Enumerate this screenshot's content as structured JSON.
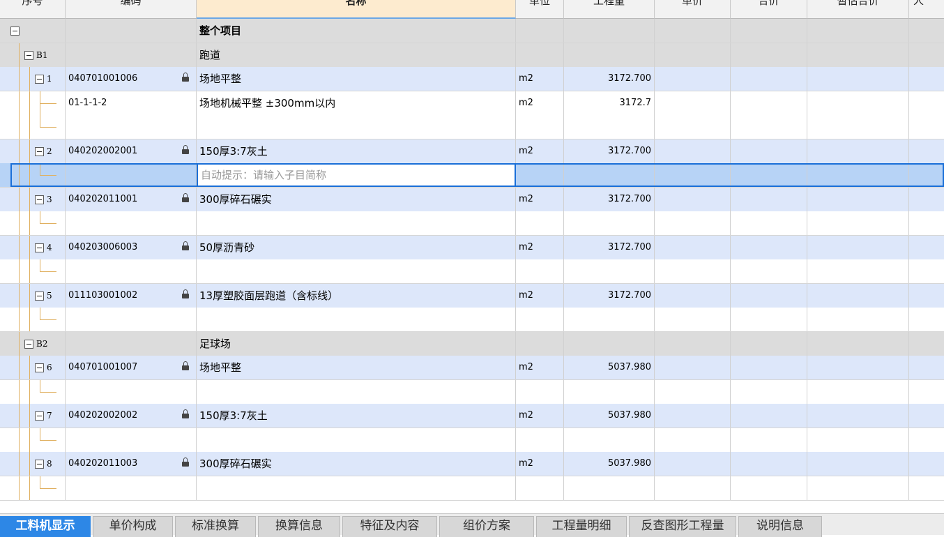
{
  "columns": {
    "seq": "序号",
    "code": "编码",
    "name": "名称",
    "unit": "单位",
    "quantity": "工程量",
    "unit_price": "单价",
    "total_price": "合价",
    "estimated_total": "暂估合价",
    "last": "人"
  },
  "rows": [
    {
      "type": "proj",
      "seq": "",
      "code": "",
      "name": "整个项目",
      "unit": "",
      "qty": ""
    },
    {
      "type": "sec",
      "seq": "B1",
      "code": "",
      "name": "跑道",
      "unit": "",
      "qty": ""
    },
    {
      "type": "item",
      "seq": "1",
      "code": "040701001006",
      "name": "场地平整",
      "unit": "m2",
      "qty": "3172.700"
    },
    {
      "type": "sub",
      "seq": "",
      "code": "01-1-1-2",
      "name": "场地机械平整 ±300mm以内",
      "unit": "m2",
      "qty": "3172.7"
    },
    {
      "type": "empty",
      "seq": "",
      "code": "",
      "name": "",
      "unit": "",
      "qty": ""
    },
    {
      "type": "item",
      "seq": "2",
      "code": "040202002001",
      "name": "150厚3:7灰土",
      "unit": "m2",
      "qty": "3172.700"
    },
    {
      "type": "active",
      "seq": "",
      "code": "",
      "name": "",
      "placeholder": "自动提示：请输入子目简称",
      "unit": "",
      "qty": ""
    },
    {
      "type": "item",
      "seq": "3",
      "code": "040202011001",
      "name": "300厚碎石碾实",
      "unit": "m2",
      "qty": "3172.700"
    },
    {
      "type": "empty",
      "seq": "",
      "code": "",
      "name": "",
      "unit": "",
      "qty": ""
    },
    {
      "type": "item",
      "seq": "4",
      "code": "040203006003",
      "name": "50厚沥青砂",
      "unit": "m2",
      "qty": "3172.700"
    },
    {
      "type": "empty",
      "seq": "",
      "code": "",
      "name": "",
      "unit": "",
      "qty": ""
    },
    {
      "type": "item",
      "seq": "5",
      "code": "011103001002",
      "name": "13厚塑胶面层跑道（含标线）",
      "unit": "m2",
      "qty": "3172.700"
    },
    {
      "type": "empty",
      "seq": "",
      "code": "",
      "name": "",
      "unit": "",
      "qty": ""
    },
    {
      "type": "sec",
      "seq": "B2",
      "code": "",
      "name": "足球场",
      "unit": "",
      "qty": ""
    },
    {
      "type": "item",
      "seq": "6",
      "code": "040701001007",
      "name": "场地平整",
      "unit": "m2",
      "qty": "5037.980"
    },
    {
      "type": "empty",
      "seq": "",
      "code": "",
      "name": "",
      "unit": "",
      "qty": ""
    },
    {
      "type": "item",
      "seq": "7",
      "code": "040202002002",
      "name": "150厚3:7灰土",
      "unit": "m2",
      "qty": "5037.980"
    },
    {
      "type": "empty",
      "seq": "",
      "code": "",
      "name": "",
      "unit": "",
      "qty": ""
    },
    {
      "type": "item",
      "seq": "8",
      "code": "040202011003",
      "name": "300厚碎石碾实",
      "unit": "m2",
      "qty": "5037.980"
    },
    {
      "type": "empty",
      "seq": "",
      "code": "",
      "name": "",
      "unit": "",
      "qty": ""
    }
  ],
  "tabs": [
    "工料机显示",
    "单价构成",
    "标准换算",
    "换算信息",
    "特征及内容",
    "组价方案",
    "工程量明细",
    "反查图形工程量",
    "说明信息"
  ],
  "selected_tab": 0,
  "colors": {
    "item_row": "#dde7fa",
    "section_row": "#dcdcdc",
    "active_row": "#b7d3f6",
    "selection_border": "#1a6fd8",
    "tab_selected": "#2d87e6"
  }
}
